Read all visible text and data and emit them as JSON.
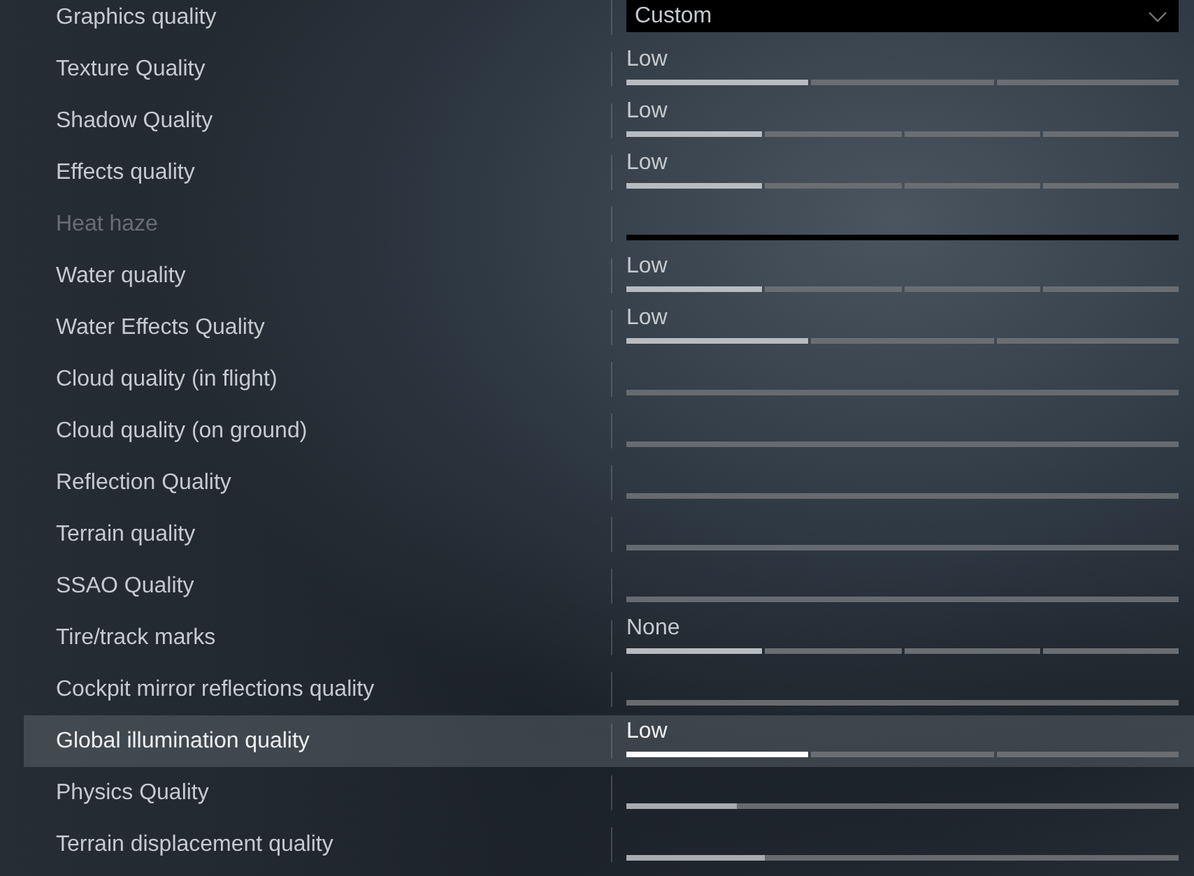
{
  "settings": [
    {
      "label": "Graphics quality",
      "kind": "dropdown",
      "value": "Custom",
      "selected": false,
      "disabled": false
    },
    {
      "label": "Texture Quality",
      "kind": "three_step",
      "value": "Low",
      "level": 0.333,
      "selected": false,
      "disabled": false
    },
    {
      "label": "Shadow Quality",
      "kind": "four_step",
      "value": "Low",
      "level": 0.25,
      "selected": false,
      "disabled": false
    },
    {
      "label": "Effects quality",
      "kind": "four_step",
      "value": "Low",
      "level": 0.25,
      "selected": false,
      "disabled": false
    },
    {
      "label": "Heat haze",
      "kind": "track",
      "selected": false,
      "disabled": true
    },
    {
      "label": "Water quality",
      "kind": "four_step",
      "value": "Low",
      "level": 0.25,
      "selected": false,
      "disabled": false
    },
    {
      "label": "Water Effects Quality",
      "kind": "three_step",
      "value": "Low",
      "level": 0.333,
      "selected": false,
      "disabled": false
    },
    {
      "label": "Cloud quality (in flight)",
      "kind": "track",
      "selected": false,
      "disabled": false
    },
    {
      "label": "Cloud quality (on ground)",
      "kind": "track",
      "selected": false,
      "disabled": false
    },
    {
      "label": "Reflection Quality",
      "kind": "track",
      "selected": false,
      "disabled": false
    },
    {
      "label": "Terrain quality",
      "kind": "track",
      "selected": false,
      "disabled": false
    },
    {
      "label": "SSAO Quality",
      "kind": "track",
      "selected": false,
      "disabled": false
    },
    {
      "label": "Tire/track marks",
      "kind": "four_step",
      "value": "None",
      "level": 0.25,
      "selected": false,
      "disabled": false
    },
    {
      "label": "Cockpit mirror reflections quality",
      "kind": "track",
      "selected": false,
      "disabled": false
    },
    {
      "label": "Global illumination quality",
      "kind": "three_step",
      "value": "Low",
      "level": 0.333,
      "selected": true,
      "disabled": false
    },
    {
      "label": "Physics Quality",
      "kind": "track",
      "level": 0.2,
      "selected": false,
      "disabled": false
    },
    {
      "label": "Terrain displacement quality",
      "kind": "track",
      "level": 0.25,
      "selected": false,
      "disabled": false
    }
  ]
}
